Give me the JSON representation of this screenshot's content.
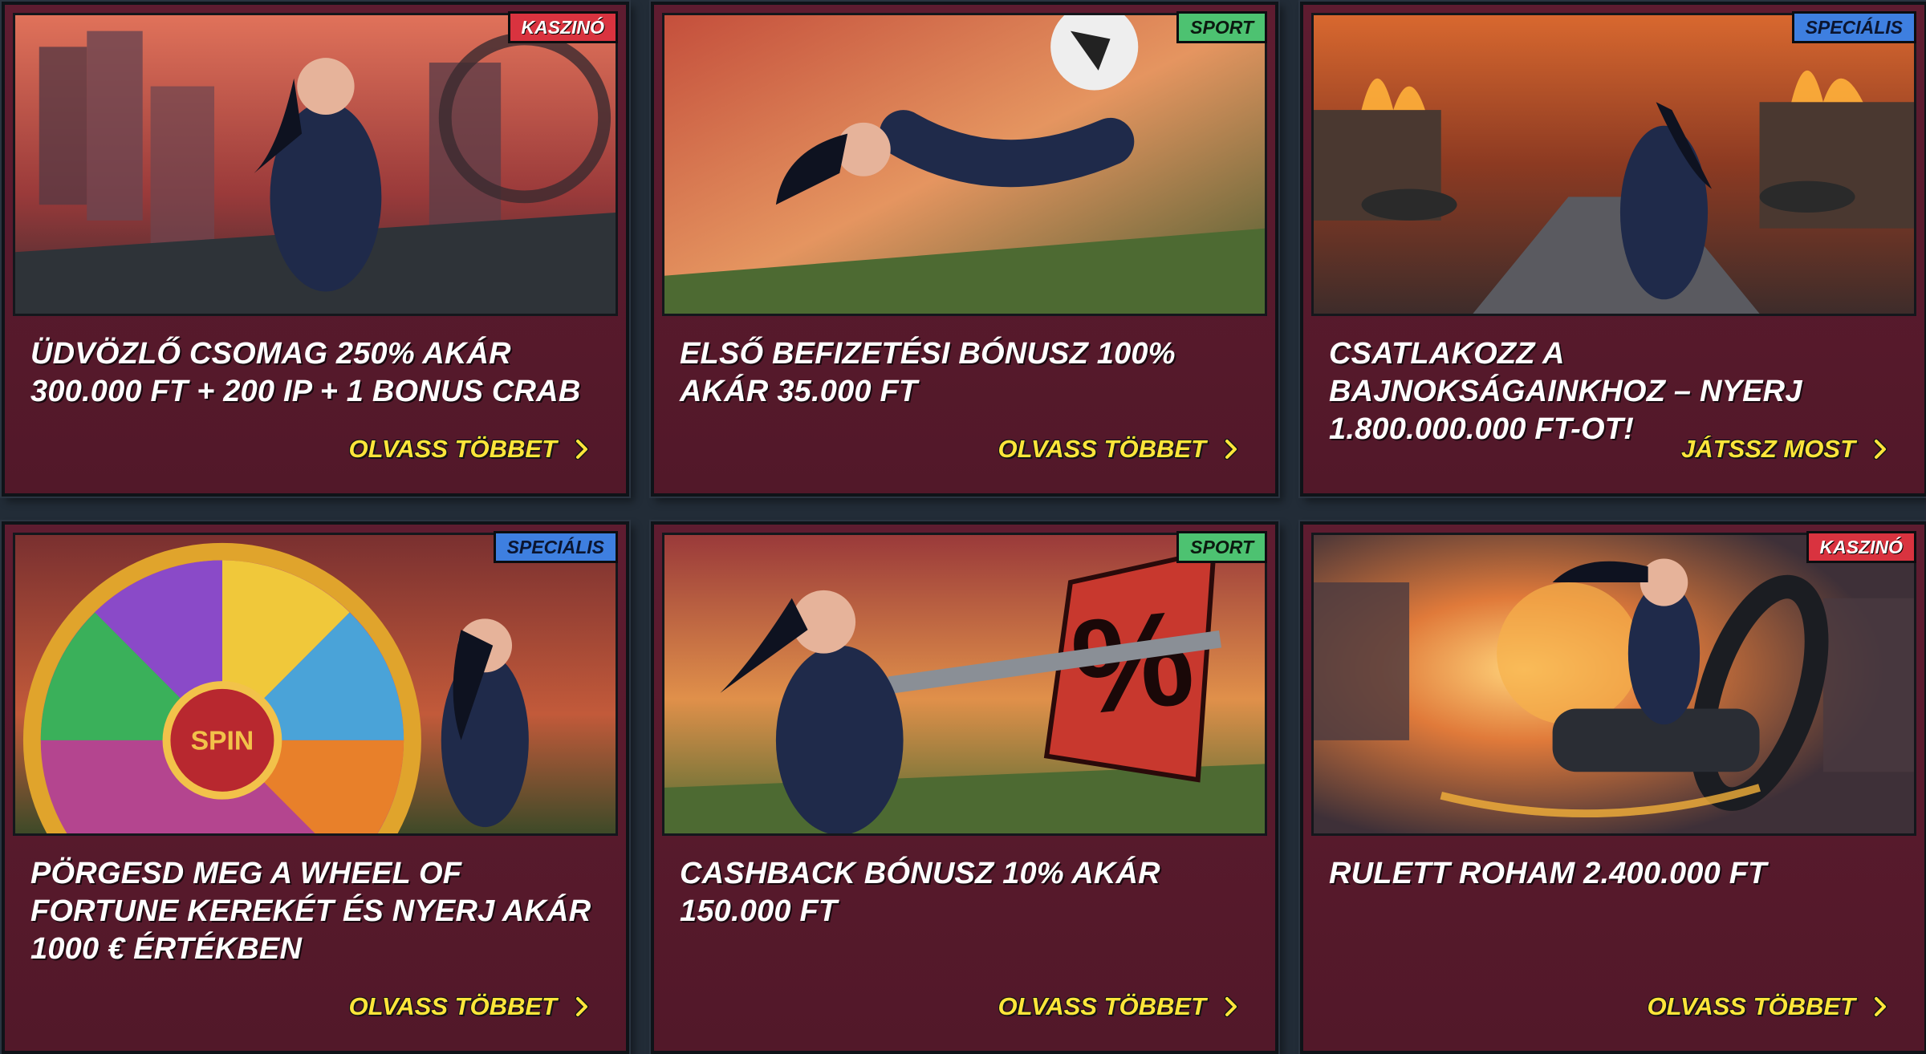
{
  "promotions": [
    {
      "badge": "KASZINÓ",
      "title": "ÜDVÖZLŐ CSOMAG 250% AKÁR 300.000 FT + 200 IP + 1 BONUS CRAB",
      "cta": "OLVASS TÖBBET",
      "badge_color": "#d9333f",
      "image_icon": "ninja-rooftop-illustration"
    },
    {
      "badge": "SPORT",
      "title": "ELSŐ BEFIZETÉSI BÓNUSZ 100% AKÁR 35.000 FT",
      "cta": "OLVASS TÖBBET",
      "badge_color": "#4dc271",
      "image_icon": "ninja-football-kick-illustration"
    },
    {
      "badge": "SPECIÁLIS",
      "title": "CSATLAKOZZ A BAJNOKSÁGAINKHOZ – NYERJ 1.800.000.000 FT-OT!",
      "cta": "JÁTSSZ MOST",
      "badge_color": "#3e7fe0",
      "image_icon": "ninja-fire-street-illustration"
    },
    {
      "badge": "SPECIÁLIS",
      "title": "PÖRGESD MEG A WHEEL OF FORTUNE KEREKÉT ÉS NYERJ AKÁR 1000 € ÉRTÉKBEN",
      "cta": "OLVASS TÖBBET",
      "badge_color": "#3e7fe0",
      "image_icon": "wheel-of-fortune-illustration",
      "wheel_label": "SPIN"
    },
    {
      "badge": "SPORT",
      "title": "CASHBACK BÓNUSZ 10% AKÁR 150.000 FT",
      "cta": "OLVASS TÖBBET",
      "badge_color": "#4dc271",
      "image_icon": "ninja-percent-sign-illustration",
      "sign_label": "%"
    },
    {
      "badge": "KASZINÓ",
      "title": "RULETT ROHAM 2.400.000 FT",
      "cta": "OLVASS TÖBBET",
      "badge_color": "#d9333f",
      "image_icon": "ninja-motorcycle-illustration"
    }
  ],
  "icons": {
    "cta_arrow": "chevron-right-icon"
  },
  "colors": {
    "page_background": "#222c37",
    "card_background": "#5a1a2d",
    "cta_text": "#ffe53a",
    "title_text": "#ffffff"
  }
}
